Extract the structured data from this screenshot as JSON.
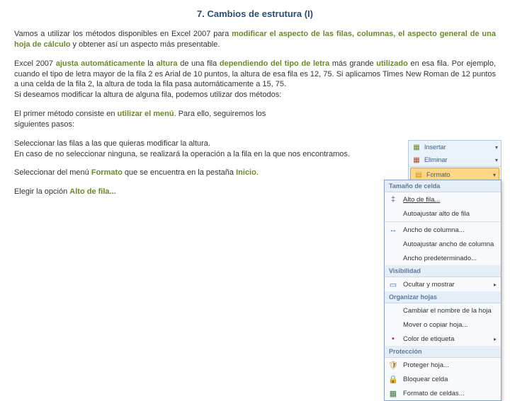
{
  "title": "7. Cambios de estrutura (I)",
  "p1": {
    "a": "Vamos a utilizar los métodos disponibles en Excel 2007 para ",
    "b": "modificar el aspecto de las filas, columnas, el aspecto general de una hoja de cálculo",
    "c": " y obtener así un aspecto más presentable."
  },
  "p2": {
    "a": "Excel 2007 ",
    "b": "ajusta automáticamente ",
    "c": "la ",
    "d": "altura",
    "e": " de una fila ",
    "f": "dependiendo del tipo de letra",
    "g": " más grande ",
    "h": "utilizado",
    "i": " en esa fila. Por ejemplo, cuando el tipo de letra mayor de la fila 2 es Arial de 10 puntos, la altura de esa fila es 12, 75. Si aplicamos Times New Roman de 12 puntos a una celda de la fila 2, la altura de toda la fila pasa automáticamente a 15, 75.",
    "j": "Si deseamos modificar la altura de alguna fila, podemos utilizar dos métodos:"
  },
  "p3": {
    "a": "El primer método consiste en ",
    "b": "utilizar el menú",
    "c": ". Para ello, seguiremos los siguientes pasos:"
  },
  "p4": {
    "a": "Seleccionar las filas a las que quieras modificar la altura.",
    "b": " En caso de no seleccionar ninguna, se realizará la operación a la fila en la que nos encontramos."
  },
  "p5": {
    "a": "Seleccionar del menú ",
    "b": "Formato",
    "c": " que se encuentra en la pestaña ",
    "d": "Inicio",
    "e": "."
  },
  "p6": {
    "a": "Elegir la opción ",
    "b": "Alto de fila..."
  },
  "ribbon": {
    "insertar": "Insertar",
    "eliminar": "Eliminar",
    "formato": "Formato"
  },
  "dd": {
    "sec1": "Tamaño de celda",
    "alto_fila": "Alto de fila...",
    "auto_alto": "Autoajustar alto de fila",
    "ancho_col": "Ancho de columna...",
    "auto_ancho": "Autoajustar ancho de columna",
    "ancho_pred": "Ancho predeterminado...",
    "sec2": "Visibilidad",
    "ocultar": "Ocultar y mostrar",
    "sec3": "Organizar hojas",
    "renombrar": "Cambiar el nombre de la hoja",
    "mover": "Mover o copiar hoja...",
    "color": "Color de etiqueta",
    "sec4": "Protección",
    "proteger": "Proteger hoja...",
    "bloquear": "Bloquear celda",
    "fmt_celdas": "Formato de celdas..."
  }
}
